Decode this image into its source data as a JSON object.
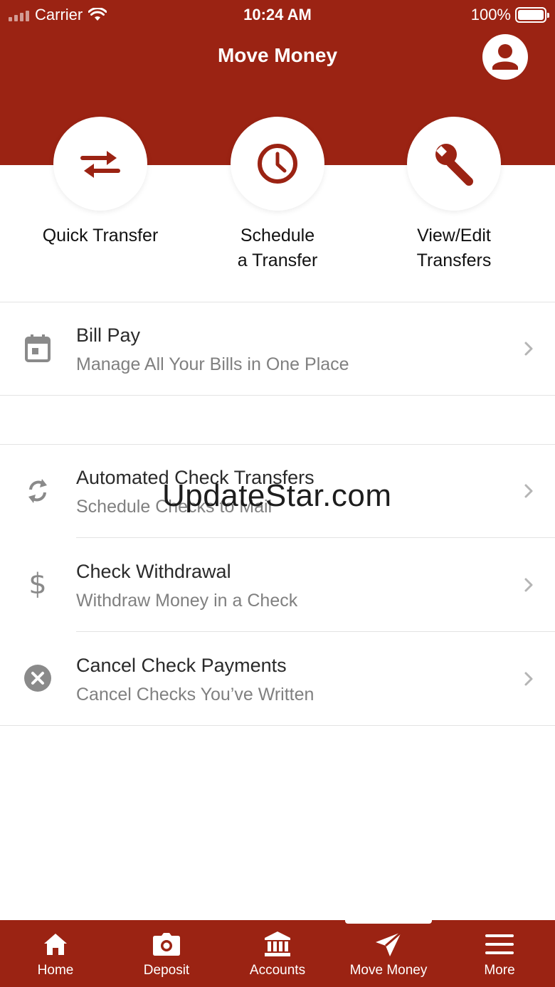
{
  "status_bar": {
    "carrier": "Carrier",
    "time": "10:24 AM",
    "battery": "100%"
  },
  "header": {
    "title": "Move Money",
    "profile_icon": "user-circle-icon"
  },
  "quick_actions": [
    {
      "line1": "Quick Transfer",
      "line2": "",
      "icon": "swap-arrows-icon"
    },
    {
      "line1": "Schedule",
      "line2": "a Transfer",
      "icon": "clock-icon"
    },
    {
      "line1": "View/Edit",
      "line2": "Transfers",
      "icon": "wrench-icon"
    }
  ],
  "list": {
    "bill_pay": {
      "title": "Bill Pay",
      "subtitle": "Manage All Your Bills in One Place",
      "icon": "calendar-icon"
    },
    "automated_check": {
      "title": "Automated Check Transfers",
      "subtitle": "Schedule Checks to Mail",
      "icon": "refresh-icon"
    },
    "check_withdrawal": {
      "title": "Check Withdrawal",
      "subtitle": "Withdraw Money in a Check",
      "icon": "dollar-icon"
    },
    "cancel_check": {
      "title": "Cancel Check Payments",
      "subtitle": "Cancel Checks You’ve Written",
      "icon": "cancel-circle-icon"
    }
  },
  "watermark": "UpdateStar.com",
  "tabbar": {
    "active": "Move Money",
    "tabs": [
      {
        "label": "Home",
        "icon": "home-icon"
      },
      {
        "label": "Deposit",
        "icon": "camera-icon"
      },
      {
        "label": "Accounts",
        "icon": "bank-icon"
      },
      {
        "label": "Move Money",
        "icon": "send-icon"
      },
      {
        "label": "More",
        "icon": "menu-icon"
      }
    ]
  },
  "colors": {
    "brand": "#9b2313",
    "text_primary": "#2a2a2a",
    "text_secondary": "#808080",
    "icon_gray": "#8a8a8a"
  }
}
